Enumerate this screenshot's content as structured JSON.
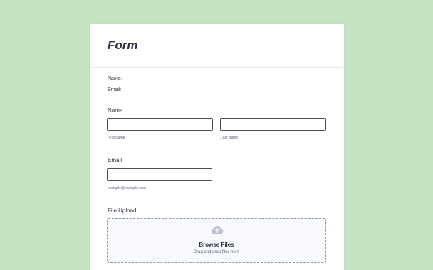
{
  "form": {
    "title": "Form",
    "summary": {
      "name_label": "Name:",
      "email_label": "Email:"
    },
    "name_field": {
      "label": "Name",
      "first": {
        "value": "",
        "sublabel": "First Name"
      },
      "last": {
        "value": "",
        "sublabel": "Last Name"
      }
    },
    "email_field": {
      "label": "Email",
      "value": "",
      "sublabel": "example@example.com"
    },
    "file_upload": {
      "label": "File Upload",
      "browse_label": "Browse Files",
      "hint": "Drag and drop files here",
      "icon": "cloud-upload-icon"
    }
  },
  "colors": {
    "background": "#c3e3c3",
    "card": "#ffffff",
    "text": "#2c3345",
    "muted": "#57647e",
    "border": "#4a4f5c"
  }
}
